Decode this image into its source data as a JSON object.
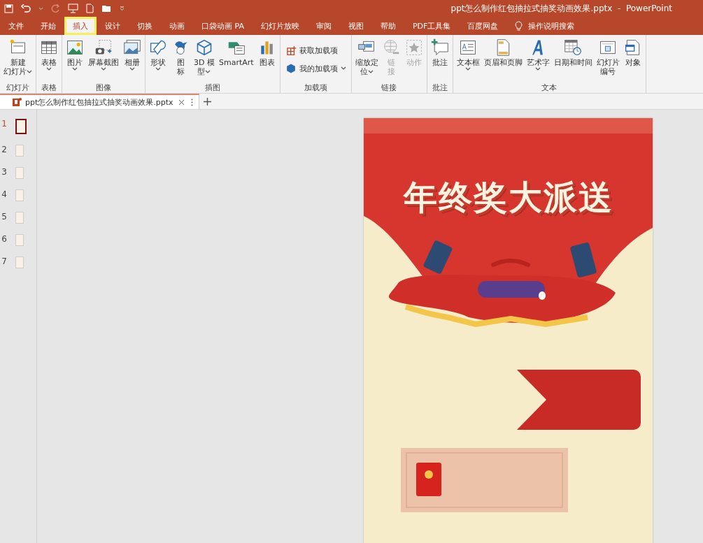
{
  "window": {
    "title": "ppt怎么制作红包抽拉式抽奖动画效果.pptx  -  PowerPoint"
  },
  "menu_tabs": [
    {
      "label": "文件",
      "selected": false
    },
    {
      "label": "开始",
      "selected": false
    },
    {
      "label": "插入",
      "selected": true
    },
    {
      "label": "设计",
      "selected": false
    },
    {
      "label": "切换",
      "selected": false
    },
    {
      "label": "动画",
      "selected": false
    },
    {
      "label": "口袋动画 PA",
      "selected": false
    },
    {
      "label": "幻灯片放映",
      "selected": false
    },
    {
      "label": "审阅",
      "selected": false
    },
    {
      "label": "视图",
      "selected": false
    },
    {
      "label": "帮助",
      "selected": false
    },
    {
      "label": "PDF工具集",
      "selected": false
    },
    {
      "label": "百度网盘",
      "selected": false
    }
  ],
  "search": {
    "placeholder": "操作说明搜索"
  },
  "ribbon": {
    "groups": [
      {
        "label": "幻灯片",
        "buttons": [
          {
            "kind": "large",
            "lines": [
              "新建",
              "幻灯片"
            ],
            "menu": true,
            "disabled": false
          }
        ]
      },
      {
        "label": "表格",
        "buttons": [
          {
            "kind": "large",
            "lines": [
              "表格"
            ],
            "menu": true,
            "disabled": false
          }
        ]
      },
      {
        "label": "图像",
        "buttons": [
          {
            "kind": "large",
            "lines": [
              "图片"
            ],
            "menu": true,
            "disabled": false
          },
          {
            "kind": "large",
            "lines": [
              "屏幕截图"
            ],
            "menu": true,
            "disabled": false
          },
          {
            "kind": "large",
            "lines": [
              "相册"
            ],
            "menu": true,
            "disabled": false
          }
        ]
      },
      {
        "label": "插图",
        "buttons": [
          {
            "kind": "large",
            "lines": [
              "形状"
            ],
            "menu": true,
            "disabled": false
          },
          {
            "kind": "large",
            "lines": [
              "图",
              "标"
            ],
            "menu": false,
            "disabled": false
          },
          {
            "kind": "large",
            "lines": [
              "3D 模",
              "型"
            ],
            "menu": true,
            "disabled": false
          },
          {
            "kind": "large",
            "lines": [
              "SmartArt"
            ],
            "menu": false,
            "disabled": false
          },
          {
            "kind": "large",
            "lines": [
              "图表"
            ],
            "menu": false,
            "disabled": false
          }
        ]
      },
      {
        "label": "加载项",
        "buttons": [
          {
            "kind": "small",
            "lines": [
              "获取加载项"
            ],
            "menu": false,
            "disabled": false
          },
          {
            "kind": "small",
            "lines": [
              "我的加载项"
            ],
            "menu": true,
            "disabled": false
          }
        ]
      },
      {
        "label": "链接",
        "buttons": [
          {
            "kind": "large",
            "lines": [
              "缩放定",
              "位"
            ],
            "menu": true,
            "disabled": false
          },
          {
            "kind": "large",
            "lines": [
              "链",
              "接"
            ],
            "menu": false,
            "disabled": true
          },
          {
            "kind": "large",
            "lines": [
              "动作"
            ],
            "menu": false,
            "disabled": true
          }
        ]
      },
      {
        "label": "批注",
        "buttons": [
          {
            "kind": "large",
            "lines": [
              "批注"
            ],
            "menu": false,
            "disabled": false
          }
        ]
      },
      {
        "label": "文本",
        "buttons": [
          {
            "kind": "large",
            "lines": [
              "文本框"
            ],
            "menu": true,
            "disabled": false
          },
          {
            "kind": "large",
            "lines": [
              "页眉和页脚"
            ],
            "menu": false,
            "disabled": false
          },
          {
            "kind": "large",
            "lines": [
              "艺术字"
            ],
            "menu": true,
            "disabled": false
          },
          {
            "kind": "large",
            "lines": [
              "日期和时间"
            ],
            "menu": false,
            "disabled": false
          },
          {
            "kind": "large",
            "lines": [
              "幻灯片",
              "编号"
            ],
            "menu": false,
            "disabled": false
          },
          {
            "kind": "large",
            "lines": [
              "对象"
            ],
            "menu": false,
            "disabled": false
          }
        ]
      }
    ]
  },
  "document_tab": {
    "title": "ppt怎么制作红包抽拉式抽奖动画效果.pptx"
  },
  "slides": [
    {
      "number": "1",
      "selected": true
    },
    {
      "number": "2",
      "selected": false
    },
    {
      "number": "3",
      "selected": false
    },
    {
      "number": "4",
      "selected": false
    },
    {
      "number": "5",
      "selected": false
    },
    {
      "number": "6",
      "selected": false
    },
    {
      "number": "7",
      "selected": false
    }
  ],
  "slide": {
    "heading": "年终奖大派送"
  }
}
